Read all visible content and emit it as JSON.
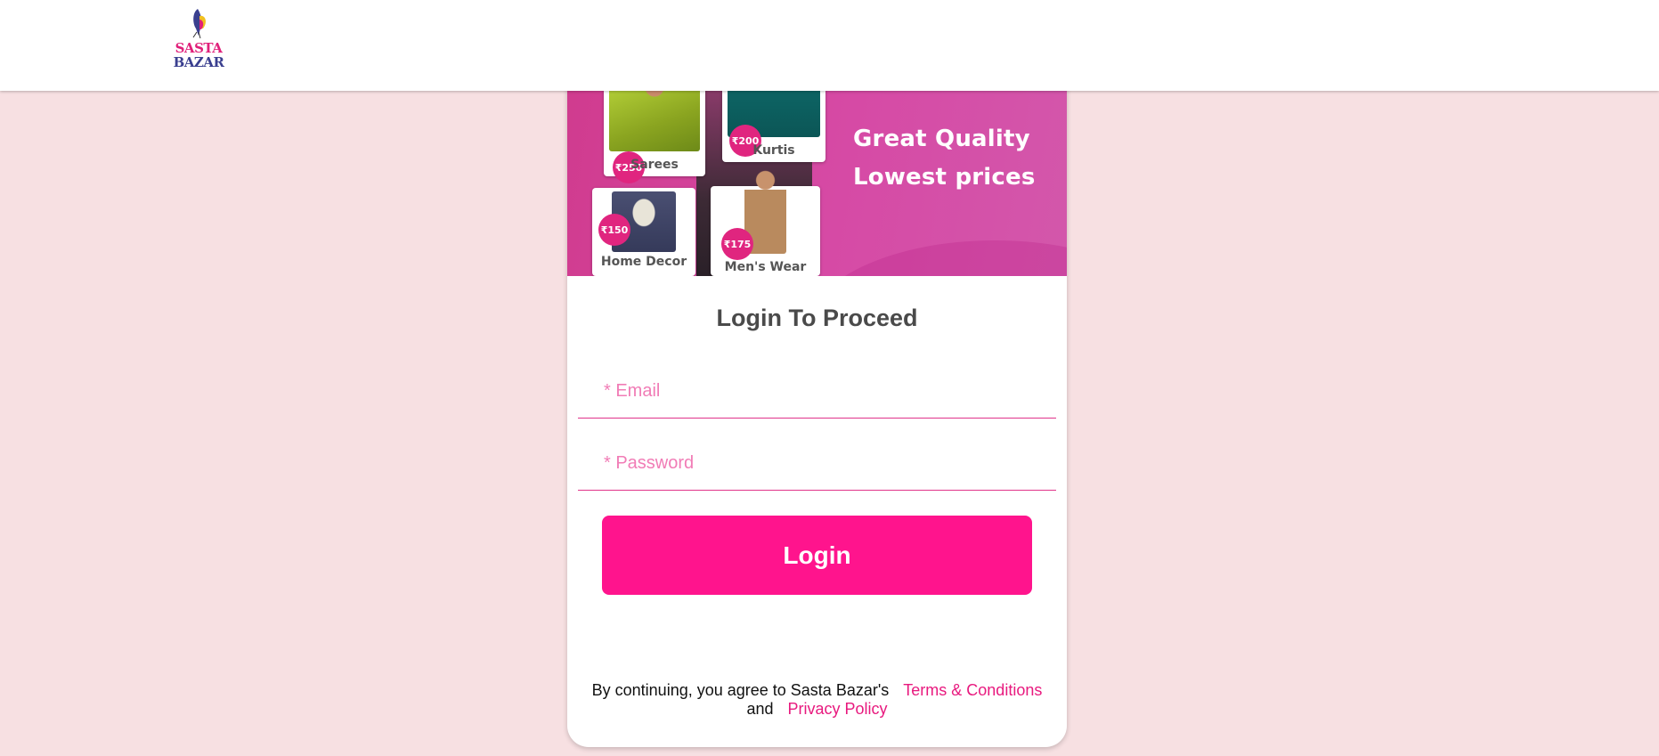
{
  "header": {
    "brand_line1": "SASTA",
    "brand_line2": "BAZAR",
    "logo_icon": "butterfly-logo-icon"
  },
  "banner": {
    "tagline_line1": "Great Quality",
    "tagline_line2": "Lowest prices",
    "products": [
      {
        "label": "Sarees",
        "price": "₹250"
      },
      {
        "label": "Kurtis",
        "price": "₹200"
      },
      {
        "label": "Home Decor",
        "price": "₹150"
      },
      {
        "label": "Men's Wear",
        "price": "₹175"
      }
    ]
  },
  "form": {
    "title": "Login To Proceed",
    "email_placeholder": "* Email",
    "email_value": "",
    "password_placeholder": "* Password",
    "password_value": "",
    "login_label": "Login"
  },
  "legal": {
    "prefix": "By continuing, you agree to Sasta Bazar's",
    "terms_label": "Terms & Conditions",
    "and_text": "and",
    "privacy_label": "Privacy Policy"
  },
  "colors": {
    "background": "#f7e0e2",
    "accent": "#ff148d",
    "link": "#e8197e",
    "banner": "#d64aa5"
  }
}
